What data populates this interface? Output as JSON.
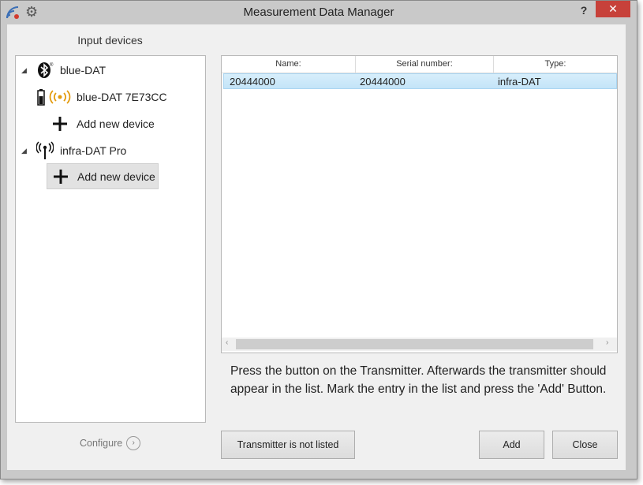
{
  "window": {
    "title": "Measurement Data Manager",
    "help": "?",
    "close": "✕"
  },
  "left": {
    "header": "Input devices",
    "tree": [
      {
        "label": "blue-DAT"
      },
      {
        "label": "blue-DAT 7E73CC"
      },
      {
        "label": "Add new device"
      },
      {
        "label": "infra-DAT Pro"
      },
      {
        "label": "Add new device"
      }
    ],
    "configure": "Configure"
  },
  "list": {
    "columns": [
      "Name:",
      "Serial number:",
      "Type:"
    ],
    "rows": [
      {
        "name": "20444000",
        "serial": "20444000",
        "type": "infra-DAT"
      }
    ]
  },
  "instructions": "Press the button on the Transmitter. Afterwards the transmitter should appear in the list. Mark the entry in the list and press the 'Add' Button.",
  "buttons": {
    "not_listed": "Transmitter is not listed",
    "add": "Add",
    "close": "Close"
  },
  "colors": {
    "accent_selected": "#c3e4f8",
    "close_button": "#c7413a"
  }
}
